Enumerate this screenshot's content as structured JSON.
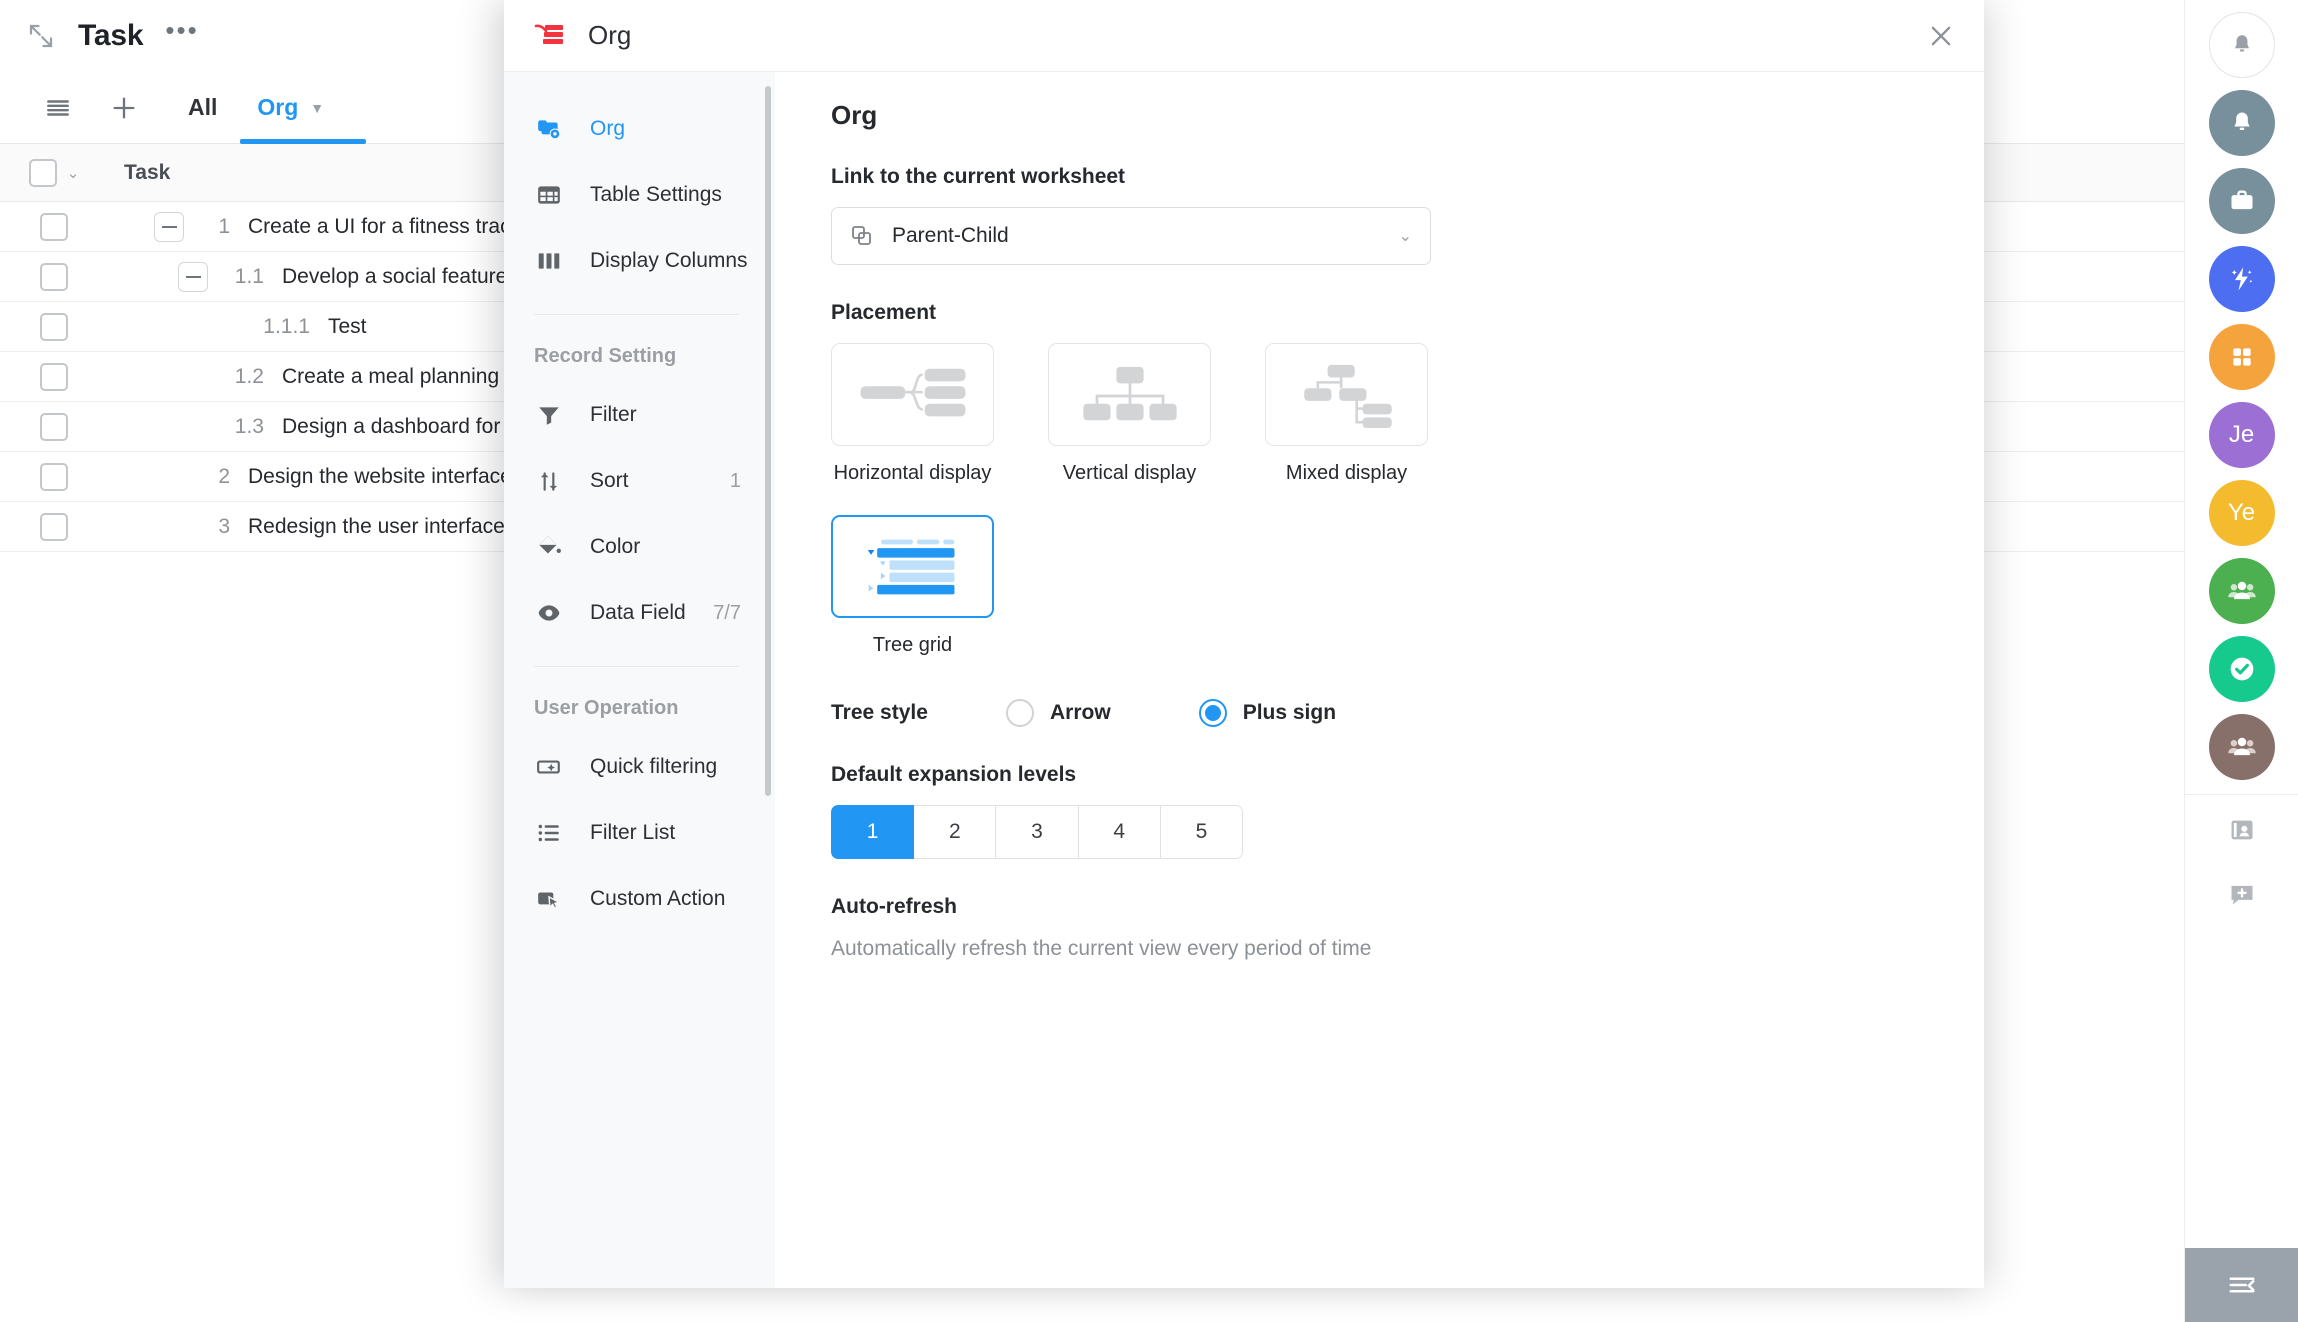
{
  "background_app": {
    "title": "Task",
    "more_icon": "ellipsis-icon",
    "expand_icon": "expand-arrows-icon",
    "toolbar": {
      "menu_icon": "list-menu-icon",
      "add_icon": "plus-icon"
    },
    "tabs": [
      {
        "label": "All",
        "active": false
      },
      {
        "label": "Org",
        "active": true,
        "caret": "chevron-down-icon"
      }
    ],
    "table": {
      "columns": [
        "Task"
      ],
      "rows": [
        {
          "toggle": "minus",
          "indent": 0,
          "number": "1",
          "title": "Create a UI for a fitness tracking app"
        },
        {
          "toggle": "minus",
          "indent": 1,
          "number": "1.1",
          "title": "Develop a social feature for shar"
        },
        {
          "toggle": "none",
          "indent": 2,
          "number": "1.1.1",
          "title": "Test"
        },
        {
          "toggle": "none",
          "indent": 1,
          "number": "1.2",
          "title": "Create a meal planning interface"
        },
        {
          "toggle": "none",
          "indent": 1,
          "number": "1.3",
          "title": "Design a dashboard for tracking"
        },
        {
          "toggle": "none",
          "indent": 0,
          "number": "2",
          "title": "Design the website interface for a foo"
        },
        {
          "toggle": "none",
          "indent": 0,
          "number": "3",
          "title": "Redesign the user interface of a popu"
        }
      ]
    }
  },
  "modal": {
    "logo_icon": "worksheet-logo-icon",
    "title": "Org",
    "close_icon": "close-icon",
    "nav": {
      "items": [
        {
          "label": "Org",
          "icon": "view-eye-icon",
          "active": true,
          "badge": ""
        },
        {
          "label": "Table Settings",
          "icon": "table-grid-icon",
          "active": false,
          "badge": ""
        },
        {
          "label": "Display Columns",
          "icon": "columns-icon",
          "active": false,
          "badge": ""
        }
      ],
      "groups": [
        {
          "label": "Record Setting",
          "items": [
            {
              "label": "Filter",
              "icon": "funnel-icon",
              "badge": ""
            },
            {
              "label": "Sort",
              "icon": "sort-arrows-icon",
              "badge": "1"
            },
            {
              "label": "Color",
              "icon": "paint-bucket-icon",
              "badge": ""
            },
            {
              "label": "Data Field",
              "icon": "eye-icon",
              "badge": "7/7"
            }
          ]
        },
        {
          "label": "User Operation",
          "items": [
            {
              "label": "Quick filtering",
              "icon": "quick-filter-icon",
              "badge": ""
            },
            {
              "label": "Filter List",
              "icon": "bullet-list-icon",
              "badge": ""
            },
            {
              "label": "Custom Action",
              "icon": "custom-action-icon",
              "badge": ""
            }
          ]
        }
      ]
    },
    "content": {
      "heading": "Org",
      "link_section": {
        "label": "Link to the current worksheet",
        "select_icon": "copy-relation-icon",
        "value": "Parent-Child",
        "caret_icon": "chevron-down-icon"
      },
      "placement": {
        "label": "Placement",
        "options": [
          {
            "label": "Horizontal display",
            "icon": "horizontal-tree-icon",
            "selected": false
          },
          {
            "label": "Vertical display",
            "icon": "vertical-tree-icon",
            "selected": false
          },
          {
            "label": "Mixed display",
            "icon": "mixed-tree-icon",
            "selected": false
          },
          {
            "label": "Tree grid",
            "icon": "tree-grid-icon",
            "selected": true
          }
        ]
      },
      "tree_style": {
        "label": "Tree style",
        "options": [
          {
            "label": "Arrow",
            "selected": false
          },
          {
            "label": "Plus sign",
            "selected": true
          }
        ]
      },
      "expansion": {
        "label": "Default expansion levels",
        "options": [
          "1",
          "2",
          "3",
          "4",
          "5"
        ],
        "selected": "1"
      },
      "auto_refresh": {
        "label": "Auto-refresh",
        "description": "Automatically refresh the current view every period of time"
      }
    }
  },
  "right_rail": {
    "items": [
      {
        "icon": "bell-outline-icon",
        "label": "",
        "color": "#ffffff"
      },
      {
        "icon": "bell-filled-icon",
        "label": "",
        "color": "#78909c"
      },
      {
        "icon": "briefcase-icon",
        "label": "",
        "color": "#78909c"
      },
      {
        "icon": "sparkle-bolt-icon",
        "label": "",
        "color": "#4d6ef0"
      },
      {
        "icon": "apps-grid-icon",
        "label": "",
        "color": "#f5a33c"
      },
      {
        "icon": "avatar-initials",
        "label": "Je",
        "color": "#9b6fd4"
      },
      {
        "icon": "avatar-initials",
        "label": "Ye",
        "color": "#f5bb2e"
      },
      {
        "icon": "group-users-icon",
        "label": "",
        "color": "#4caf50"
      },
      {
        "icon": "check-circle-icon",
        "label": "",
        "color": "#16c98d"
      },
      {
        "icon": "group-users-icon",
        "label": "",
        "color": "#87706a"
      }
    ],
    "flat_items": [
      {
        "icon": "contact-card-icon"
      },
      {
        "icon": "chat-add-icon"
      }
    ],
    "bottom": {
      "icon": "collapse-panel-icon"
    }
  },
  "colors": {
    "accent": "#2196f3",
    "brand_red": "#f5333f",
    "rail_bottom": "#9aa2ab"
  }
}
